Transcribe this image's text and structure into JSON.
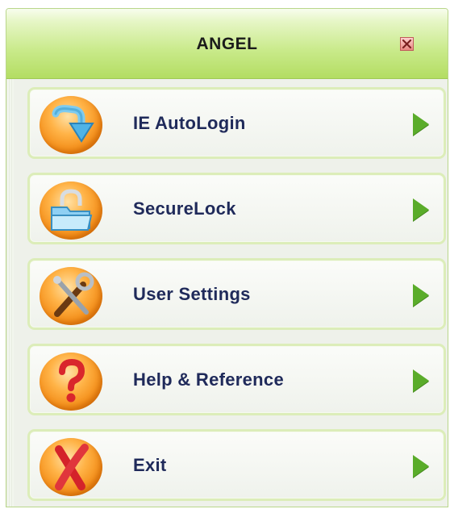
{
  "window": {
    "title": "ANGEL",
    "close_icon": "close-icon"
  },
  "menu": {
    "items": [
      {
        "label": "IE AutoLogin",
        "icon": "download-arrow-icon"
      },
      {
        "label": "SecureLock",
        "icon": "folder-lock-icon"
      },
      {
        "label": "User Settings",
        "icon": "tools-icon"
      },
      {
        "label": "Help & Reference",
        "icon": "question-mark-icon"
      },
      {
        "label": "Exit",
        "icon": "exit-x-icon"
      }
    ]
  },
  "colors": {
    "titlebar_accent": "#b3dd62",
    "item_border": "#dcedb9",
    "label_text": "#1f2a5a",
    "arrow": "#5aac2a",
    "icon_orange": "#f28a14"
  }
}
